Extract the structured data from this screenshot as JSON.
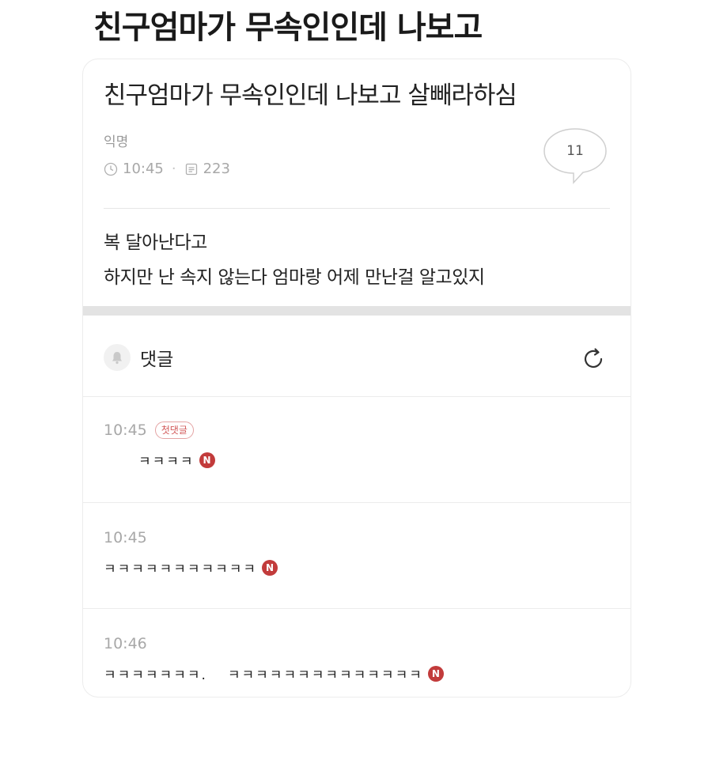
{
  "headline": "친구엄마가 무속인인데 나보고",
  "post": {
    "title": "친구엄마가 무속인인데 나보고 살빼라하심",
    "author": "익명",
    "time": "10:45",
    "views": "223",
    "comment_count": "11",
    "body_lines": [
      "복 달아난다고",
      "하지만 난 속지 않는다 엄마랑 어제 만난걸 알고있지"
    ]
  },
  "comments_section": {
    "header_label": "댓글"
  },
  "comments": [
    {
      "time": "10:45",
      "badge": "첫댓글",
      "text": "ㅋㅋㅋㅋ",
      "text2": "",
      "new_badge": "N"
    },
    {
      "time": "10:45",
      "badge": "",
      "text": "ㅋㅋㅋㅋㅋㅋㅋㅋㅋㅋㅋ",
      "text2": "",
      "new_badge": "N"
    },
    {
      "time": "10:46",
      "badge": "",
      "text": "ㅋㅋㅋㅋㅋㅋㅋ.",
      "text2": "ㅋㅋㅋㅋㅋㅋㅋㅋㅋㅋㅋㅋㅋㅋ",
      "new_badge": "N"
    }
  ],
  "colors": {
    "badge_red": "#c23b3b",
    "meta_gray": "#a8a8a8"
  }
}
